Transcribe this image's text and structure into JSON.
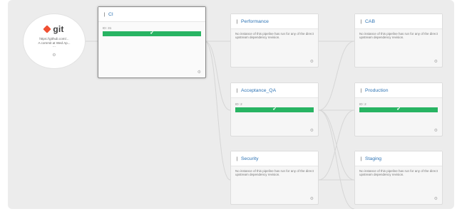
{
  "material": {
    "icon": "git-icon",
    "name": "git",
    "url": "https://github.com/...",
    "comment": "A commit at Wed Ap...",
    "ellipsis": "...",
    "gear_icon": "gear-icon"
  },
  "pipelines": {
    "ci": {
      "name": "CI",
      "run_label": "ID: 31",
      "status": "passed",
      "status_color": "#28b463"
    },
    "performance": {
      "name": "Performance",
      "message": "No instance of this pipeline has run for any of the direct upstream dependency revision."
    },
    "acceptance_qa": {
      "name": "Acceptance_QA",
      "run_label": "ID: 2",
      "status": "passed",
      "status_color": "#28b463"
    },
    "security": {
      "name": "Security",
      "message": "No instance of this pipeline has run for any of the direct upstream dependency revision."
    },
    "cab": {
      "name": "CAB",
      "message": "No instance of this pipeline has run for any of the direct upstream dependency revision."
    },
    "production": {
      "name": "Production",
      "run_label": "ID: 2",
      "status": "passed",
      "status_color": "#28b463"
    },
    "staging": {
      "name": "Staging",
      "message": "No instance of this pipeline has run for any of the direct upstream dependency revision."
    }
  },
  "icons": {
    "pipeline": "pipeline-icon",
    "check": "check-icon",
    "gear": "gear-icon"
  }
}
